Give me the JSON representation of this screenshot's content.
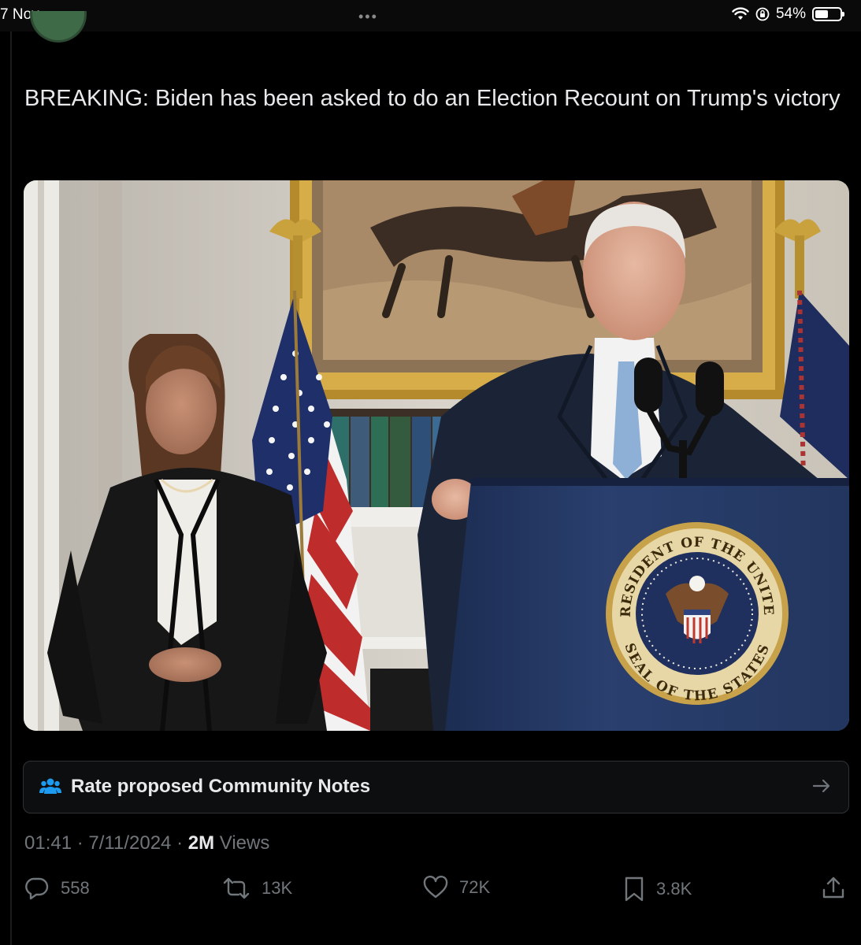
{
  "status_bar": {
    "date": "7 Nov",
    "battery": "54%",
    "battery_level": 0.54
  },
  "post": {
    "text": "BREAKING: Biden has been asked to do an Election Recount on Trump's victory"
  },
  "photo": {
    "seal_top": "PRESIDENT OF THE UNITED",
    "seal_bottom": "SEAL OF THE STATES"
  },
  "community_notes": {
    "label": "Rate proposed Community Notes"
  },
  "meta": {
    "time": "01:41",
    "date": "7/11/2024",
    "views_count": "2M",
    "views_label": "Views"
  },
  "actions": {
    "replies": "558",
    "reposts": "13K",
    "likes": "72K",
    "bookmarks": "3.8K"
  },
  "colors": {
    "background": "#000000",
    "text": "#e7e9ea",
    "muted": "#71767b",
    "notes_icon": "#1d9bf0"
  }
}
